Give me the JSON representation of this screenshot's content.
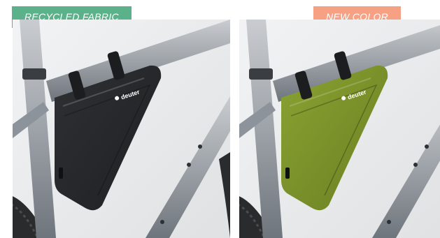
{
  "badges": {
    "left": {
      "label": "RECYCLED FABRIC",
      "color": "#5bb28a"
    },
    "right": {
      "label": "NEW COLOR",
      "color": "#f7a184"
    }
  },
  "products": [
    {
      "brand_mark": "deuter",
      "bag_color": "#2e3033",
      "bag_shade": "#1e2022"
    },
    {
      "brand_mark": "deuter",
      "bag_color": "#8aa232",
      "bag_shade": "#6a7f22"
    }
  ]
}
